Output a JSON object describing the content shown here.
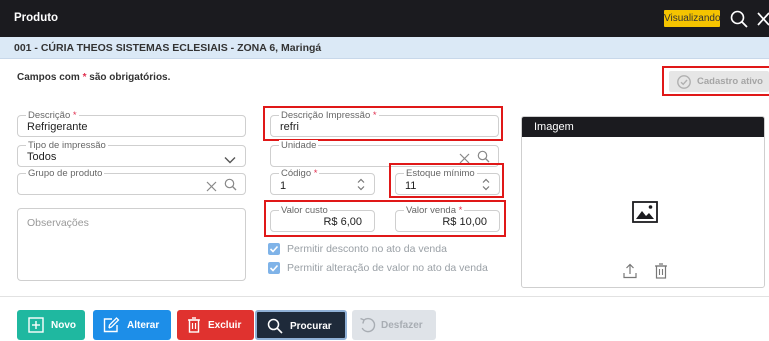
{
  "header": {
    "title": "Produto",
    "mode_badge": "Visualizando"
  },
  "company": {
    "line": "001 - CÚRIA THEOS SISTEMAS ECLESIAIS - ZONA 6, Maringá"
  },
  "form": {
    "required_note_prefix": "Campos com",
    "required_star": "*",
    "required_note_suffix": "são obrigatórios.",
    "status_button": "Cadastro ativo",
    "descricao": {
      "label": "Descrição",
      "value": "Refrigerante"
    },
    "descricao_impressao": {
      "label": "Descrição Impressão",
      "value": "refri"
    },
    "tipo_impressao": {
      "label": "Tipo de impressão",
      "value": "Todos"
    },
    "unidade": {
      "label": "Unidade",
      "value": ""
    },
    "grupo_produto": {
      "label": "Grupo de produto",
      "value": ""
    },
    "codigo": {
      "label": "Código",
      "value": "1"
    },
    "estoque_minimo": {
      "label": "Estoque mínimo",
      "value": "11"
    },
    "observacoes": {
      "placeholder": "Observações"
    },
    "valor_custo": {
      "label": "Valor custo",
      "value": "R$ 6,00"
    },
    "valor_venda": {
      "label": "Valor venda",
      "value": "R$ 10,00"
    },
    "checkbox_desconto": {
      "label": "Permitir desconto no ato da venda",
      "checked": true
    },
    "checkbox_alteracao": {
      "label": "Permitir alteração de valor no ato da venda",
      "checked": true
    }
  },
  "image_panel": {
    "title": "Imagem",
    "icons": [
      "image-placeholder-icon",
      "upload-icon",
      "trash-icon"
    ]
  },
  "toolbar": {
    "novo": "Novo",
    "alterar": "Alterar",
    "excluir": "Excluir",
    "procurar": "Procurar",
    "desfazer": "Desfazer"
  },
  "colors": {
    "titlebar": "#1b1b1f",
    "badge": "#f5c400",
    "subbar": "#dbe9f6",
    "required": "#e03050",
    "highlight": "#e01818",
    "novo": "#1fb8a0",
    "alterar": "#1d8ee8",
    "excluir": "#e0322f",
    "procurar": "#1e2a3a",
    "desfazer": "#dfe3e8"
  }
}
